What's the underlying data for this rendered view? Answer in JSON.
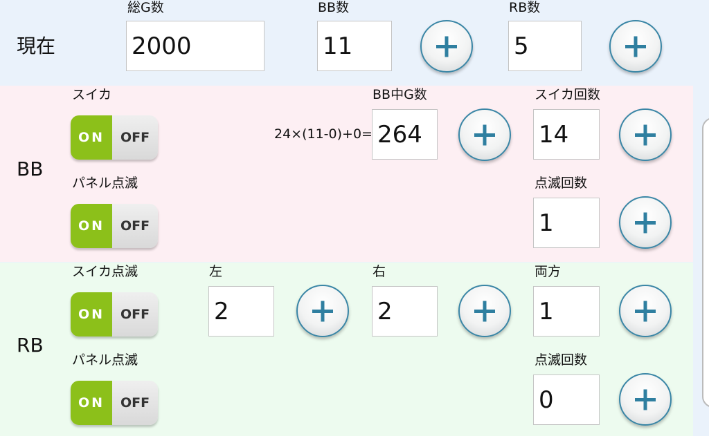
{
  "current": {
    "row_label": "現在",
    "total_g_label": "総G数",
    "total_g_value": "2000",
    "bb_label": "BB数",
    "bb_value": "11",
    "rb_label": "RB数",
    "rb_value": "5"
  },
  "bb": {
    "section_label": "BB",
    "suika_label": "スイカ",
    "panel_label": "パネル点滅",
    "bb_g_label": "BB中G数",
    "formula": "24×(11-0)+0=",
    "bb_g_value": "264",
    "suika_count_label": "スイカ回数",
    "suika_count_value": "14",
    "blink_count_label": "点滅回数",
    "blink_count_value": "1"
  },
  "rb": {
    "section_label": "RB",
    "suika_blink_label": "スイカ点滅",
    "panel_label": "パネル点滅",
    "left_label": "左",
    "left_value": "2",
    "right_label": "右",
    "right_value": "2",
    "both_label": "両方",
    "both_value": "1",
    "blink_count_label": "点滅回数",
    "blink_count_value": "0"
  },
  "toggle": {
    "on_label": "ON",
    "off_label": "OFF"
  },
  "colors": {
    "background": "#eaf2fb",
    "bb_section": "#fdeff3",
    "rb_section": "#edfbef",
    "toggle_on": "#8cc01a",
    "plus_accent": "#2f7fa0"
  },
  "icons": {
    "plus_button": "plus-icon"
  }
}
